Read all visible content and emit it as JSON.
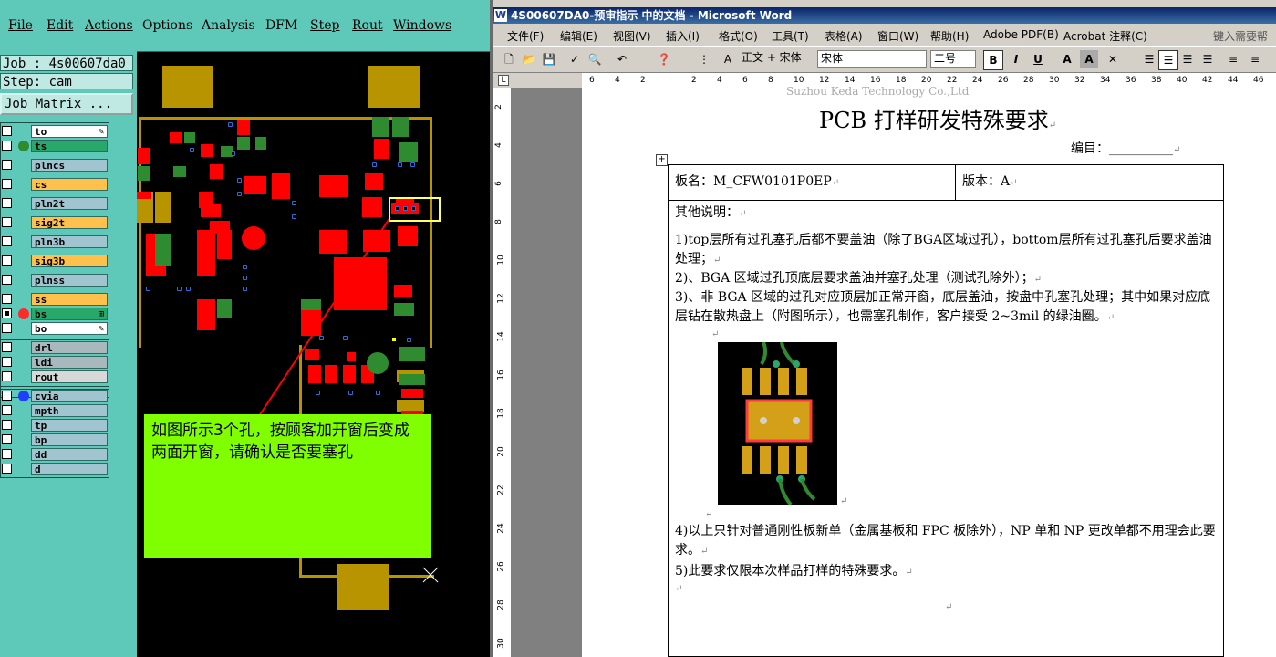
{
  "cam": {
    "menu": [
      "File",
      "Edit",
      "Actions",
      "Options",
      "Analysis",
      "DFM",
      "Step",
      "Rout",
      "Windows"
    ],
    "job_label": "Job : 4s00607da0",
    "step_label": "Step: cam",
    "job_matrix": "Job Matrix ...",
    "layers": [
      {
        "name": "to",
        "color": "#ffffff",
        "checked": false,
        "marker": "✎"
      },
      {
        "name": "ts",
        "color": "#2aa86b",
        "checked": false,
        "dot": "#2f8b2f"
      },
      {
        "name": "plncs",
        "color": "#a0c4d0",
        "checked": false
      },
      {
        "name": "cs",
        "color": "#ffc04c",
        "checked": false
      },
      {
        "name": "pln2t",
        "color": "#a0c4d0",
        "checked": false
      },
      {
        "name": "sig2t",
        "color": "#ffc04c",
        "checked": false
      },
      {
        "name": "pln3b",
        "color": "#a0c4d0",
        "checked": false
      },
      {
        "name": "sig3b",
        "color": "#ffc04c",
        "checked": false
      },
      {
        "name": "plnss",
        "color": "#a0c4d0",
        "checked": false
      },
      {
        "name": "ss",
        "color": "#ffc04c",
        "checked": false
      },
      {
        "name": "bs",
        "color": "#2aa86b",
        "checked": true,
        "dot": "#ff2a2a",
        "marker": "⊞"
      },
      {
        "name": "bo",
        "color": "#ffffff",
        "checked": false,
        "marker": "✎"
      },
      {
        "name": "drl",
        "color": "#a8b8bc",
        "checked": false
      },
      {
        "name": "ldi",
        "color": "#a8b8bc",
        "checked": false
      },
      {
        "name": "rout",
        "color": "#d8d8d8",
        "checked": false
      },
      {
        "name": "cvia",
        "color": "#a0c4d0",
        "checked": false,
        "dot": "#1f3fff"
      },
      {
        "name": "mpth",
        "color": "#a0c4d0",
        "checked": false
      },
      {
        "name": "tp",
        "color": "#a0c4d0",
        "checked": false
      },
      {
        "name": "bp",
        "color": "#a0c4d0",
        "checked": false
      },
      {
        "name": "dd",
        "color": "#a0c4d0",
        "checked": false
      },
      {
        "name": "d",
        "color": "#a0c4d0",
        "checked": false
      }
    ],
    "note": "如图所示3个孔，按顾客加开窗后变成两面开窗，请确认是否要塞孔"
  },
  "word": {
    "title": "4S00607DA0-预审指示 中的文档 - Microsoft Word",
    "menu": [
      "文件(F)",
      "编辑(E)",
      "视图(V)",
      "插入(I)",
      "格式(O)",
      "工具(T)",
      "表格(A)",
      "窗口(W)",
      "帮助(H)",
      "Adobe PDF(B)",
      "Acrobat 注释(C)"
    ],
    "help_box": "键入需要帮助",
    "style": "正文 + 宋体",
    "font": "宋体",
    "size": "二号",
    "ruler_h": [
      "6",
      "4",
      "2",
      "",
      "2",
      "4",
      "6",
      "8",
      "10",
      "12",
      "14",
      "16",
      "18",
      "20",
      "22",
      "24",
      "26",
      "28",
      "30",
      "32",
      "34",
      "36",
      "38",
      "40",
      "42",
      "44",
      "46"
    ],
    "ruler_v": [
      "2",
      "4",
      "6",
      "8",
      "10",
      "12",
      "14",
      "16",
      "18",
      "20",
      "22",
      "24",
      "26",
      "28",
      "30"
    ],
    "header_faint": "Suzhou Keda Technology Co.,Ltd",
    "doc_title": "PCB 打样研发特殊要求",
    "number_label": "编目：__________",
    "board_name": "板名：M_CFW0101P0EP",
    "version": "版本：A",
    "other": "其他说明：",
    "p1": "1)top层所有过孔塞孔后都不要盖油（除了BGA区域过孔），bottom层所有过孔塞孔后要求盖油处理；",
    "p2": "2)、BGA 区域过孔顶底层要求盖油并塞孔处理（测试孔除外）；",
    "p3": "3)、非 BGA 区域的过孔对应顶层加正常开窗，底层盖油，按盘中孔塞孔处理；其中如果对应底层钻在散热盘上（附图所示），也需塞孔制作，客户接受 2~3mil 的绿油圈。",
    "p4": "4)以上只针对普通刚性板新单（金属基板和 FPC 板除外），NP 单和 NP 更改单都不用理会此要求。",
    "p5": "5)此要求仅限本次样品打样的特殊要求。"
  }
}
